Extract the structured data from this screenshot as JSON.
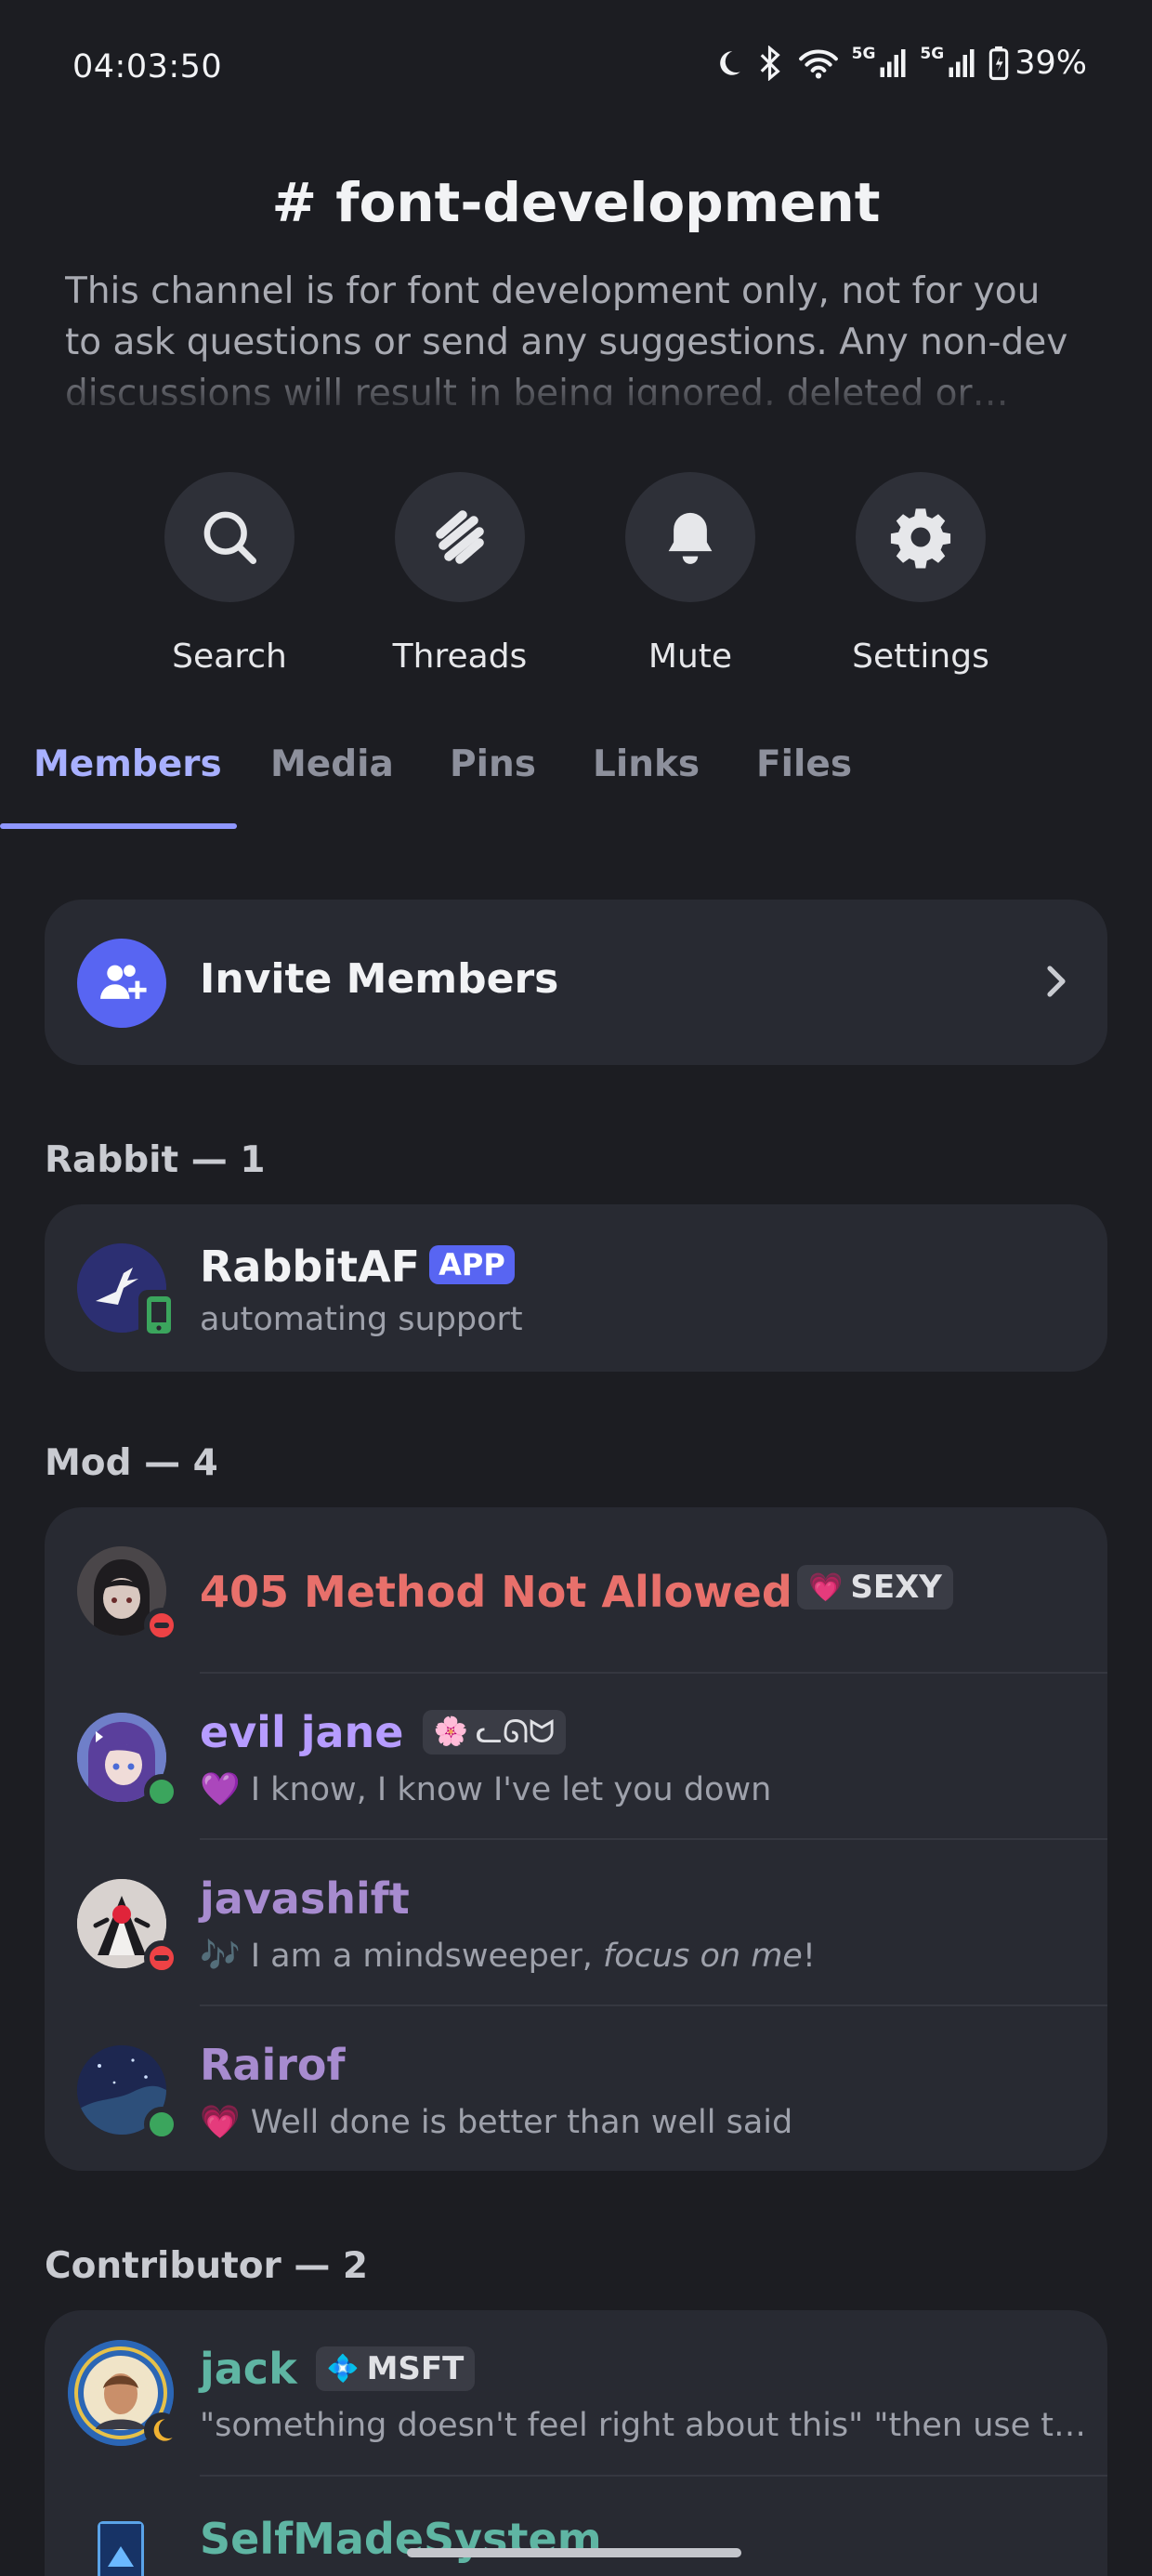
{
  "status_bar": {
    "time": "04:03:50",
    "battery": "39%",
    "network_1": "5G",
    "network_2": "5G"
  },
  "channel": {
    "title": "# font-development",
    "description": "This channel is for font development only, not for you to ask questions or send any suggestions. Any non-dev discussions will result in being ignored, deleted or muted."
  },
  "actions": [
    {
      "label": "Search",
      "icon": "search-icon"
    },
    {
      "label": "Threads",
      "icon": "threads-icon"
    },
    {
      "label": "Mute",
      "icon": "bell-icon"
    },
    {
      "label": "Settings",
      "icon": "gear-icon"
    }
  ],
  "tabs": [
    "Members",
    "Media",
    "Pins",
    "Links",
    "Files"
  ],
  "active_tab": "Members",
  "invite": {
    "label": "Invite Members"
  },
  "sections": [
    {
      "header": "Rabbit — 1",
      "members": [
        {
          "name": "RabbitAF",
          "badge": "APP",
          "status": "automating support",
          "status_color": "#3ba55d",
          "name_color": "#f2f3f5"
        }
      ]
    },
    {
      "header": "Mod — 4",
      "members": [
        {
          "name": "405 Method Not Allowed",
          "tag": "SEXY",
          "tag_emoji": "💗",
          "status": "",
          "status_color": "#ed4245",
          "name_color": "#e8706b"
        },
        {
          "name": "evil jane",
          "tag": "ᓚᘏᗢ",
          "tag_emoji": "🌸",
          "status": "I know, I know I've let you down",
          "status_emoji": "💜",
          "status_color": "#3ba55d",
          "name_color": "#b69cff"
        },
        {
          "name": "javashift",
          "status": "I am a mindsweeper, focus on me!",
          "status_plain": "I am a mindsweeper, ",
          "status_em": "focus on me",
          "status_end": "!",
          "status_emoji": "🎶",
          "status_color": "#ed4245",
          "name_color": "#a78bcf"
        },
        {
          "name": "Rairof",
          "status": "Well done is better than well said",
          "status_emoji": "💗",
          "status_color": "#3ba55d",
          "name_color": "#a78bcf"
        }
      ]
    },
    {
      "header": "Contributor — 2",
      "members": [
        {
          "name": "jack",
          "tag": "MSFT",
          "tag_emoji": "💠",
          "status": "\"something doesn't feel right about this\" \"then use t…",
          "status_color": "#f0b232",
          "name_color": "#5fb5a3"
        },
        {
          "name": "SelfMadeSystem",
          "status": "",
          "name_color": "#5fb5a3"
        }
      ]
    }
  ],
  "colors": {
    "background": "#1c1d22",
    "card": "#282a32",
    "accent": "#5865f2",
    "tab_active": "#a8b0ff"
  }
}
